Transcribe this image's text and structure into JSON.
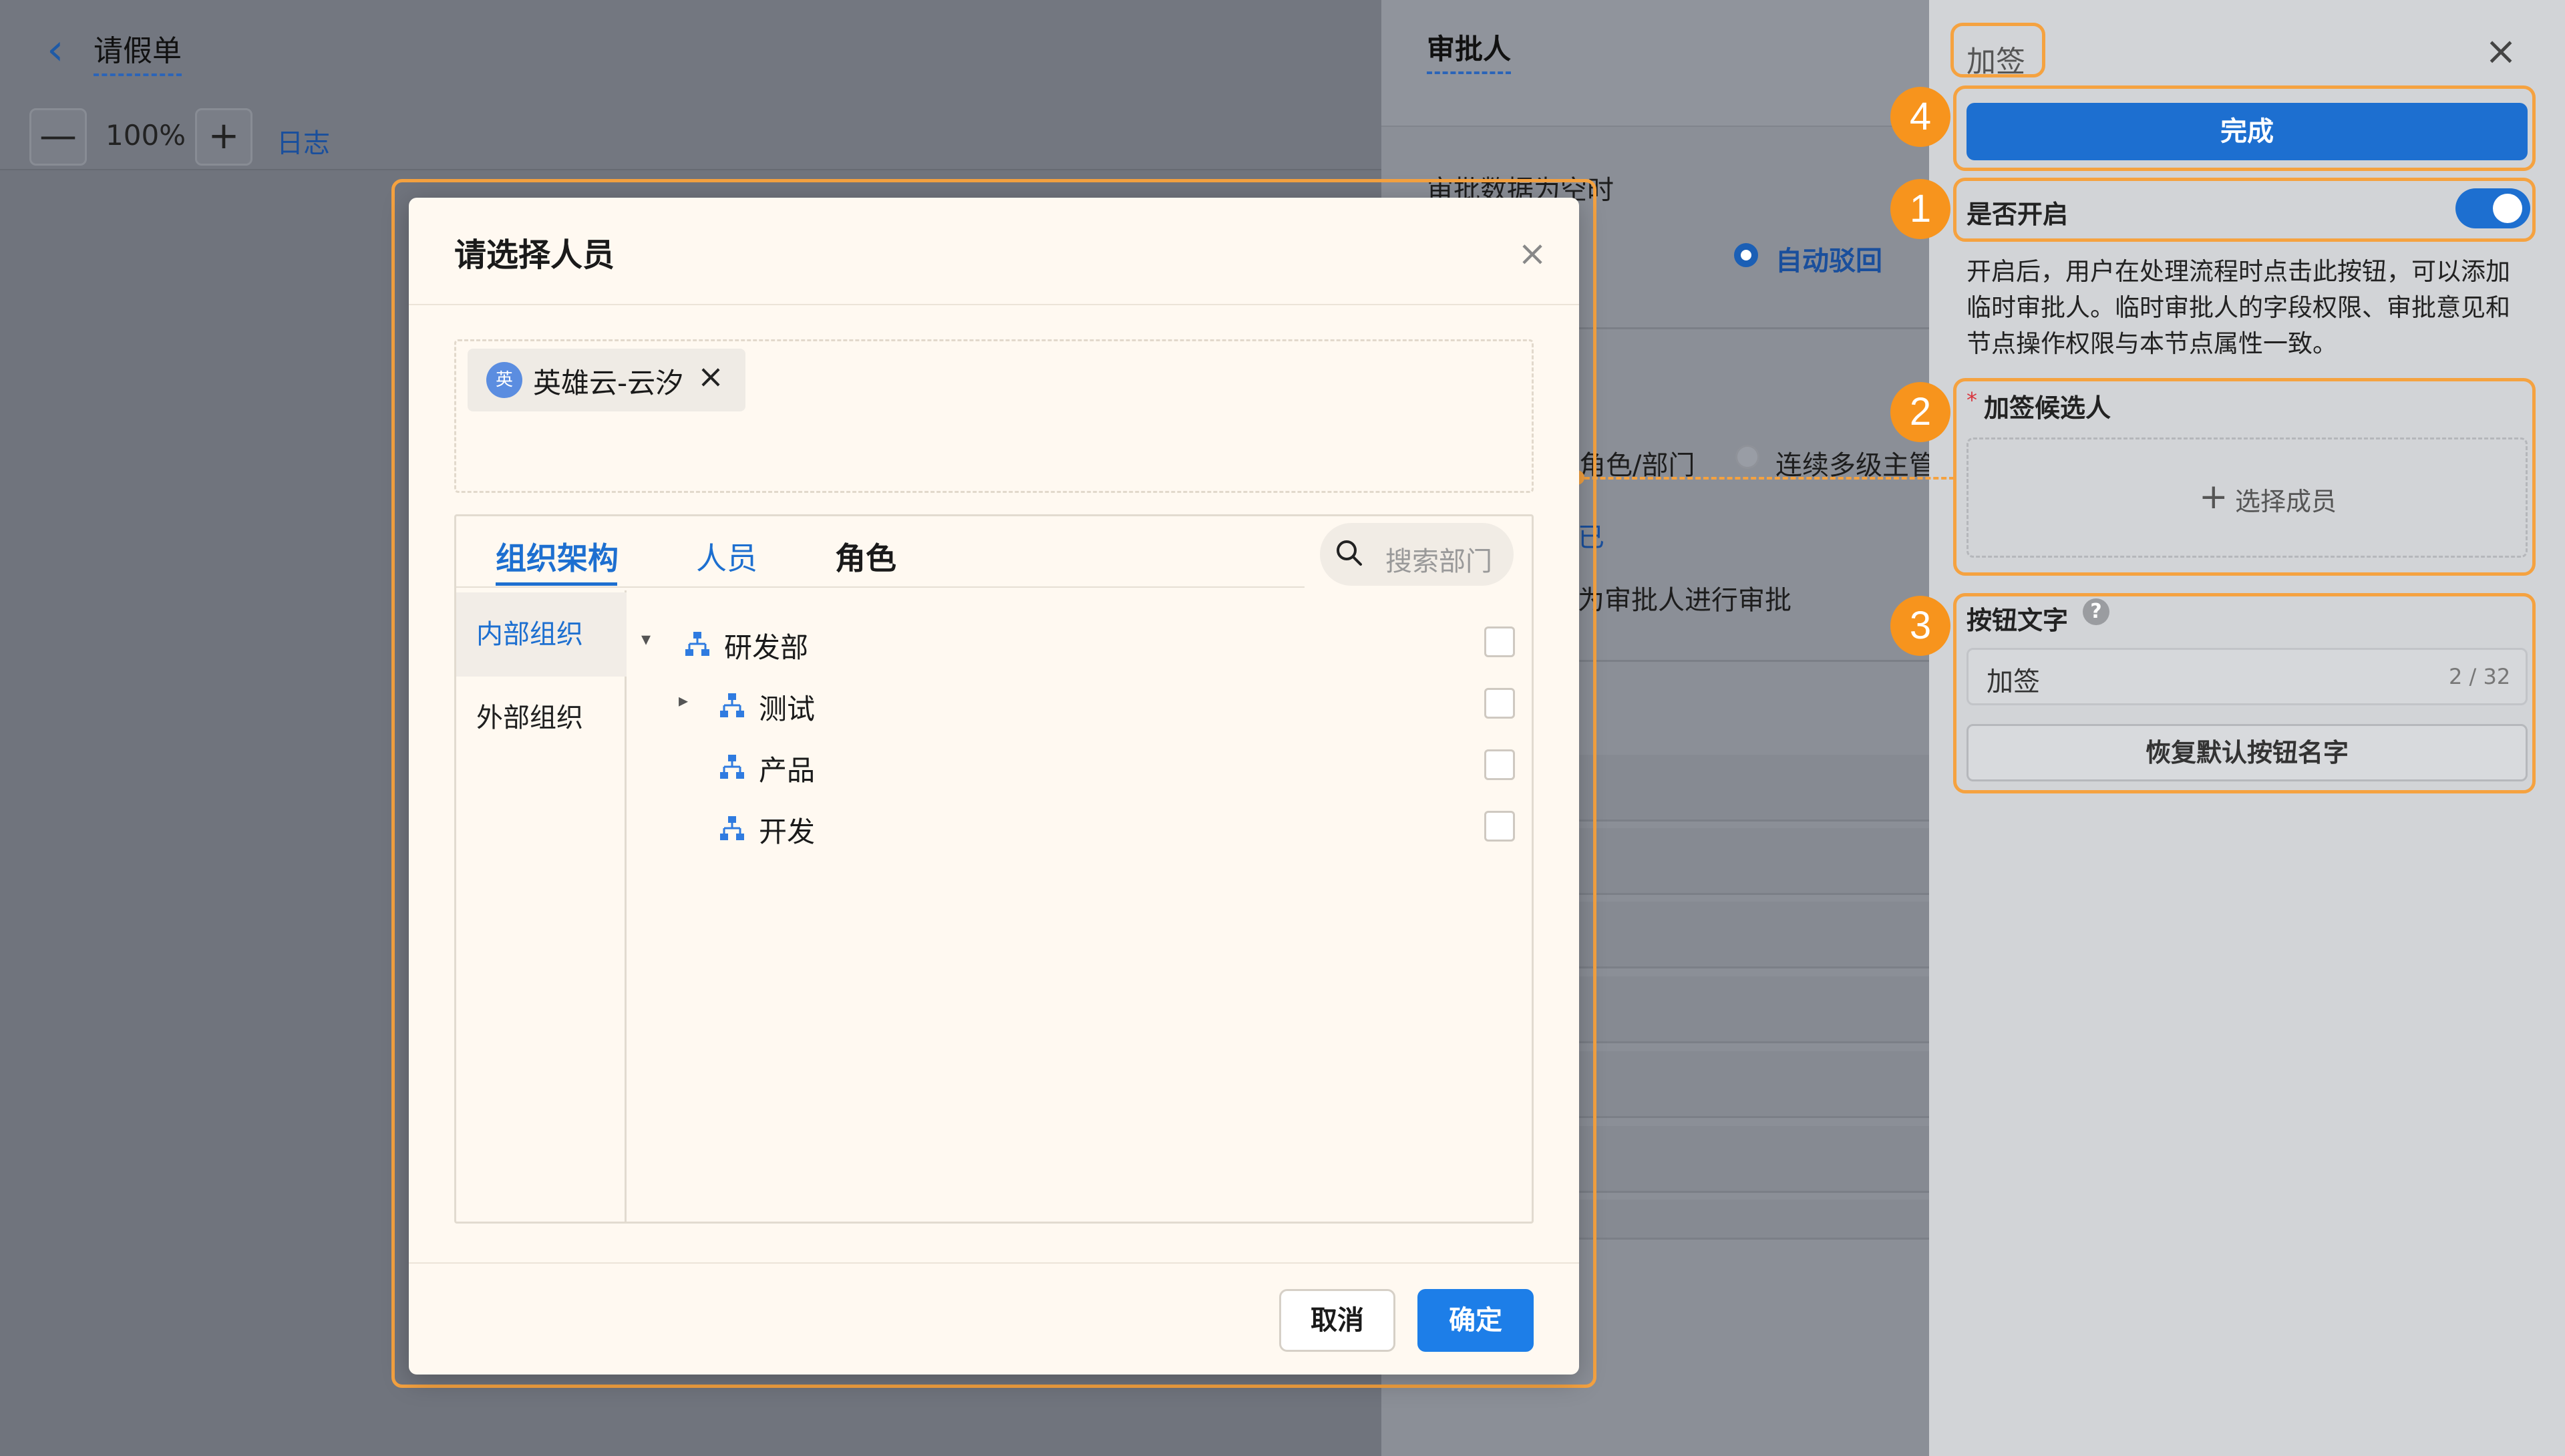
{
  "app": {
    "doc_title": "请假单",
    "zoom": {
      "minus": "—",
      "value": "100%",
      "plus": "+"
    },
    "log_link": "日志"
  },
  "approver_panel": {
    "title": "审批人",
    "empty_data_label": "审批数据为空时",
    "auto_reject": "自动驳回",
    "option_role_dept": "角色/部门",
    "option_multi_manager": "连续多级主管",
    "partial_text": "已",
    "approve_as_text": "为审批人进行审批"
  },
  "countersign_panel": {
    "title": "加签",
    "done_button": "完成",
    "enable_label": "是否开启",
    "enabled": true,
    "description": "开启后，用户在处理流程时点击此按钮，可以添加临时审批人。临时审批人的字段权限、审批意见和节点操作权限与本节点属性一致。",
    "candidates_label": "加签候选人",
    "required_mark": "*",
    "select_member": "选择成员",
    "button_text_label": "按钮文字",
    "help": "?",
    "button_text_value": "加签",
    "button_text_count": "2 / 32",
    "reset_button": "恢复默认按钮名字",
    "badges": [
      "1",
      "2",
      "3",
      "4"
    ]
  },
  "modal": {
    "title": "请选择人员",
    "selected": [
      {
        "avatar": "英",
        "name": "英雄云-云汐"
      }
    ],
    "tabs": [
      "组织架构",
      "人员",
      "角色"
    ],
    "active_tab": 0,
    "search_placeholder": "搜索部门",
    "side_nav": [
      "内部组织",
      "外部组织"
    ],
    "tree": [
      {
        "label": "研发部",
        "caret": "▾"
      },
      {
        "label": "测试",
        "caret": "▸"
      },
      {
        "label": "产品",
        "caret": ""
      },
      {
        "label": "开发",
        "caret": ""
      }
    ],
    "cancel": "取消",
    "confirm": "确定"
  },
  "colors": {
    "accent": "#1d6fd0",
    "highlight": "#f5a240",
    "badge": "#f7941d"
  }
}
